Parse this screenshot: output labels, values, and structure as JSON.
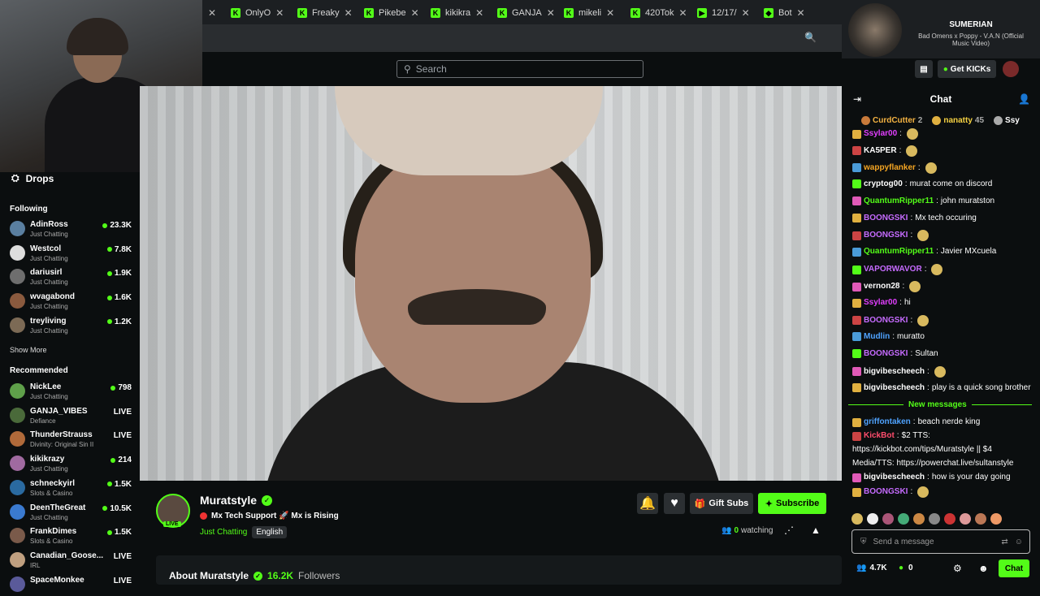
{
  "tabs": [
    {
      "label": "OnlyO",
      "fav": "K"
    },
    {
      "label": "Freaky",
      "fav": "K"
    },
    {
      "label": "Pikebe",
      "fav": "K"
    },
    {
      "label": "kikikra",
      "fav": "K"
    },
    {
      "label": "GANJA",
      "fav": "K"
    },
    {
      "label": "mikeli",
      "fav": "K"
    },
    {
      "label": "420Tok",
      "fav": "K"
    },
    {
      "label": "12/17/",
      "fav": "▶"
    },
    {
      "label": "Bot",
      "fav": "◆"
    }
  ],
  "search": {
    "placeholder": "Search"
  },
  "media": {
    "title": "SUMERIAN",
    "subtitle": "Bad Omens x Poppy - V.A.N (Official Music Video)"
  },
  "header": {
    "get_kicks": "Get KICKs"
  },
  "sidebar": {
    "drops": "Drops",
    "following_title": "Following",
    "following": [
      {
        "name": "AdinRoss",
        "category": "Just Chatting",
        "viewers": "23.3K",
        "color": "#5a7fa0"
      },
      {
        "name": "Westcol",
        "category": "Just Chatting",
        "viewers": "7.8K",
        "color": "#dddddd"
      },
      {
        "name": "dariusirl",
        "category": "Just Chatting",
        "viewers": "1.9K",
        "color": "#6e6e6e"
      },
      {
        "name": "wvagabond",
        "category": "Just Chatting",
        "viewers": "1.6K",
        "color": "#8a5a3e"
      },
      {
        "name": "treyliving",
        "category": "Just Chatting",
        "viewers": "1.2K",
        "color": "#7c6a55"
      }
    ],
    "show_more": "Show More",
    "recommended_title": "Recommended",
    "recommended": [
      {
        "name": "NickLee",
        "category": "Just Chatting",
        "viewers": "798",
        "color": "#5fa04a"
      },
      {
        "name": "GANJA_VIBES",
        "category": "Defiance",
        "viewers": "LIVE",
        "color": "#4a6a3a"
      },
      {
        "name": "ThunderStrauss",
        "category": "Divinity: Original Sin II",
        "viewers": "LIVE",
        "color": "#b06a3a"
      },
      {
        "name": "kikikrazy",
        "category": "Just Chatting",
        "viewers": "214",
        "color": "#a06aa0"
      },
      {
        "name": "schneckyirl",
        "category": "Slots & Casino",
        "viewers": "1.5K",
        "color": "#2a6aa0"
      },
      {
        "name": "DeenTheGreat",
        "category": "Just Chatting",
        "viewers": "10.5K",
        "color": "#3a7ad0"
      },
      {
        "name": "FrankDimes",
        "category": "Slots & Casino",
        "viewers": "1.5K",
        "color": "#7a5a4a"
      },
      {
        "name": "Canadian_Goose...",
        "category": "IRL",
        "viewers": "LIVE",
        "color": "#c0a080"
      },
      {
        "name": "SpaceMonkee",
        "category": "",
        "viewers": "LIVE",
        "color": "#5a5a9a"
      }
    ]
  },
  "stream": {
    "channel": "Muratstyle",
    "title": "Mx Tech Support 🚀 Mx is Rising",
    "category": "Just Chatting",
    "language": "English",
    "live_badge": "LIVE",
    "gift_subs": "Gift Subs",
    "subscribe": "Subscribe",
    "watching_count": "0",
    "watching_label": "watching",
    "about_label": "About Muratstyle",
    "followers_count": "16.2K",
    "followers_label": "Followers"
  },
  "chat": {
    "title": "Chat",
    "top_gifters": [
      {
        "name": "CurdCutter",
        "count": "2"
      },
      {
        "name": "nanatty",
        "count": "45"
      },
      {
        "name": "Ssy",
        "count": ""
      }
    ],
    "messages": [
      {
        "user": "Ssylar00",
        "text": "",
        "color": "#e23fff"
      },
      {
        "user": "KA5PER",
        "text": "",
        "color": "#ffffff"
      },
      {
        "user": "wappyflanker",
        "text": "",
        "color": "#f5a623"
      },
      {
        "user": "cryptog00",
        "text": "murat come on discord",
        "color": "#ffffff"
      },
      {
        "user": "QuantumRipper11",
        "text": "john muratston",
        "color": "#53fc18"
      },
      {
        "user": "BOONGSKI",
        "text": "Mx tech occuring",
        "color": "#c66bff"
      },
      {
        "user": "BOONGSKI",
        "text": "",
        "color": "#c66bff"
      },
      {
        "user": "QuantumRipper11",
        "text": "Javier MXcuela",
        "color": "#53fc18"
      },
      {
        "user": "VAPORWAVOR",
        "text": "",
        "color": "#c66bff"
      },
      {
        "user": "vernon28",
        "text": "",
        "color": "#ffffff"
      },
      {
        "user": "Ssylar00",
        "text": "hi",
        "color": "#e23fff"
      },
      {
        "user": "BOONGSKI",
        "text": "",
        "color": "#c66bff"
      },
      {
        "user": "Mudlin",
        "text": "muratto",
        "color": "#4fa3ff"
      },
      {
        "user": "BOONGSKI",
        "text": "Sultan",
        "color": "#c66bff"
      },
      {
        "user": "bigvibescheech",
        "text": "",
        "color": "#ffffff"
      },
      {
        "user": "bigvibescheech",
        "text": "play is a quick song brother",
        "color": "#ffffff"
      }
    ],
    "new_messages": "New messages",
    "messages2": [
      {
        "user": "griffontaken",
        "text": "beach nerde king",
        "color": "#4fa3ff"
      },
      {
        "user": "KickBot",
        "text": "$2 TTS:",
        "color": "#ff4d6d"
      },
      {
        "user": "",
        "text": "https://kickbot.com/tips/Muratstyle || $4",
        "color": "#ffffff"
      },
      {
        "user": "",
        "text": "Media/TTS: https://powerchat.live/sultanstyle",
        "color": "#ffffff"
      },
      {
        "user": "bigvibescheech",
        "text": "how is your day going",
        "color": "#ffffff"
      },
      {
        "user": "BOONGSKI",
        "text": "",
        "color": "#c66bff"
      }
    ],
    "input_placeholder": "Send a message",
    "viewer_count": "4.7K",
    "kicks_count": "0",
    "chat_button": "Chat"
  },
  "colors": {
    "accent": "#53fc18",
    "bg": "#0b0e0f"
  }
}
